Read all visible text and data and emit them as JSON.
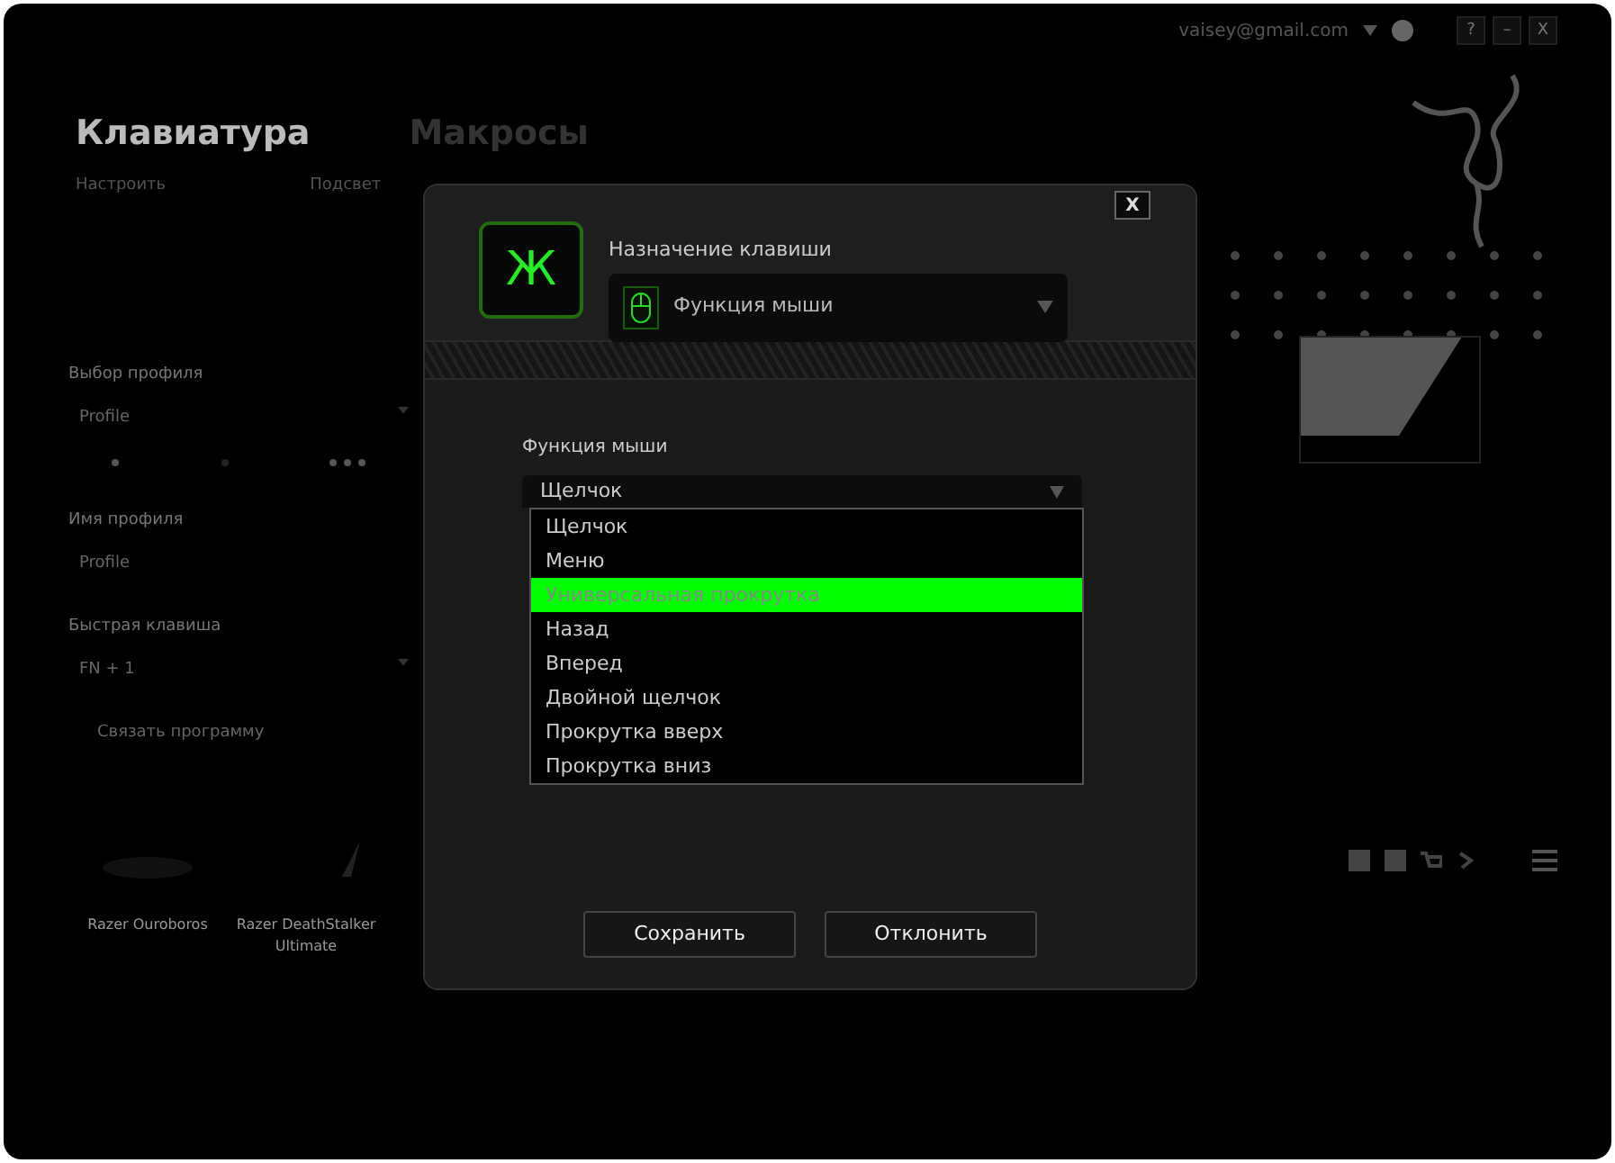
{
  "window": {
    "account": "vaisey@gmail.com",
    "buttons": [
      "?",
      "–",
      "X"
    ]
  },
  "tabs": [
    {
      "label": "Клавиатура",
      "selected": true
    },
    {
      "label": "Макросы",
      "selected": false
    }
  ],
  "subtabs": [
    {
      "label": "Настроить"
    },
    {
      "label": "Подсвет"
    }
  ],
  "profile_panel": {
    "fields": [
      {
        "label": "Выбор профиля",
        "value": "Profile",
        "kind": "dropdown"
      },
      {
        "label": "Имя профиля",
        "value": "Profile",
        "kind": "text"
      },
      {
        "label": "Быстрая клавиша",
        "value": "FN + 1",
        "kind": "dropdown"
      }
    ],
    "link": "Связать программу"
  },
  "devices": [
    {
      "name": "Razer Ouroboros"
    },
    {
      "name": "Razer DeathStalker Ultimate"
    }
  ],
  "dialog": {
    "close": "X",
    "key": "Ж",
    "assignment_label": "Назначение клавиши",
    "assignment_value": "Функция мыши",
    "function_label": "Функция мыши",
    "function_value": "Щелчок",
    "options": [
      {
        "label": "Щелчок",
        "selected": false
      },
      {
        "label": "Меню",
        "selected": false
      },
      {
        "label": "Универсальная прокрутка",
        "selected": true
      },
      {
        "label": "Назад",
        "selected": false
      },
      {
        "label": "Вперед",
        "selected": false
      },
      {
        "label": "Двойной щелчок",
        "selected": false
      },
      {
        "label": "Прокрутка вверх",
        "selected": false
      },
      {
        "label": "Прокрутка вниз",
        "selected": false
      }
    ],
    "buttons": [
      "Сохранить",
      "Отклонить"
    ]
  }
}
